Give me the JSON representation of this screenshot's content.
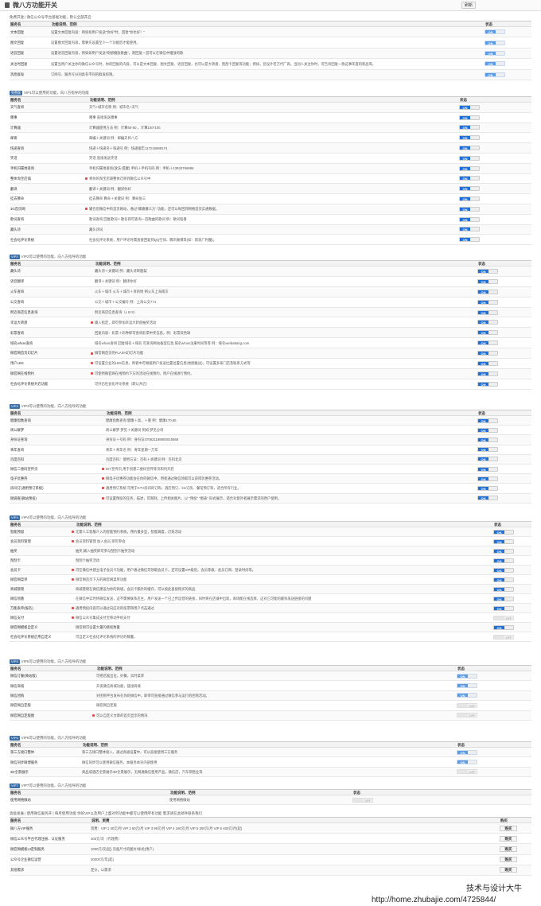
{
  "page": {
    "title": "微八方功能开关",
    "refresh_label": "刷新"
  },
  "colors": {
    "on": "#1e6fd9",
    "hot": "#e04848",
    "badge": "#3c6ea8"
  },
  "sections": [
    {
      "badge": "",
      "head": "免费开放 | 微信公众号平台基础功能，默认全部开启",
      "cols": [
        "服务名",
        "功能说明、范例",
        "状态"
      ],
      "colw": [
        52,
        545,
        59
      ],
      "rows": [
        {
          "n": "文本回复",
          "d": "设置文本回复内容：例如如用户发送\"你好\"时，回复\"你也好！\"",
          "s": "on",
          "lite": true
        },
        {
          "n": "图文回复",
          "d": "设置图文回复内容，需要先设置至少一个功能后才能使用。",
          "s": "on",
          "lite": true
        },
        {
          "n": "语音回复",
          "d": "设置语音回复内容，例如如用户发送\"刚想播放歌曲\"，则回复一首可以在微信中播放的歌",
          "s": "on",
          "lite": true
        },
        {
          "n": "关注时回复",
          "d": "设置当用户关注你的微信公众号时，你的回复的内容，可以是文本回复、图文回复、语音回复，也可以是大转盘、刮刮卡回复等功能；例如，您设计若万代厂商，当别人关注你时，可告诉回复一款这事年度的新品等。",
          "s": "on",
          "lite": true
        },
        {
          "n": "消息群发",
          "d": "订阅号、服务号分别具有不同的群发权限。",
          "s": "on",
          "lite": true
        }
      ],
      "hots": []
    },
    {
      "badge": "免费版",
      "head": "VIP1可以使用的功能，向八方指导的功能",
      "cols": [
        "服务名",
        "功能说明、范例",
        "状态"
      ],
      "colw": [
        100,
        465,
        91
      ],
      "rows": [
        {
          "n": "天气查询",
          "d": "天气+城市名称 例：城市名+天气",
          "s": "on"
        },
        {
          "n": "糗事",
          "d": "糗事    直接发送糗事",
          "s": "on"
        },
        {
          "n": "计算器",
          "d": "计算器使用方法   例：计算50-50    ，计算100*100",
          "s": "on"
        },
        {
          "n": "邮寄",
          "d": "邮编＋关键词   例：邮编天目八方",
          "s": "on"
        },
        {
          "n": "快递查询",
          "d": "快递＋快递名＋快递号   例：快递顺丰117215889174",
          "s": "on"
        },
        {
          "n": "笑话",
          "d": "笑话    直接发送笑话",
          "s": "on"
        },
        {
          "n": "手机归属地查询",
          "d": "手机归属地查询(放法:提醒)  手机＋手机号码   例：手机＋13933766996",
          "s": "on"
        },
        {
          "n": "整体淘宝店铺",
          "d": "将你的淘宝店铺整体迁移到微信公众号中",
          "s": "on",
          "hot": true
        },
        {
          "n": "翻译",
          "d": "翻译＋关键词  例：翻译你好",
          "s": "on"
        },
        {
          "n": "挂去算命",
          "d": "挂去算命 算命＋关键词   例：算命张三",
          "s": "on"
        },
        {
          "n": "3G首页网",
          "d": "输合您微信中的首页网站，通过\"输输播三方\" 功能，还可以每回到网络首页实通数据。",
          "s": "on",
          "hot": true
        },
        {
          "n": "歌词查询",
          "d": "歌词查询 回复歌词＋歌名即可查询一首歌曲的歌词 例：歌词稻香",
          "s": "on"
        },
        {
          "n": "藏头诗",
          "d": "藏头诗词",
          "s": "on"
        },
        {
          "n": "社会化评论系统",
          "d": "社会化评论系统，用户评论时需直接回复到QQ空间、腾讯微博等(如：新浪广利魔)。",
          "s": "on"
        }
      ]
    },
    {
      "badge": "VIP2",
      "head": "VIP2可以使用的功能，向八方指导的功能",
      "cols": [
        "服务名",
        "功能说明、范例",
        "状态"
      ],
      "colw": [
        107,
        481,
        68
      ],
      "rows": [
        {
          "n": "藏头诗",
          "d": "藏头诗＋关键词   例：藏头诗转题梨",
          "s": "on"
        },
        {
          "n": "语音翻译",
          "d": "翻译＋关键词   例：翻译你好",
          "s": "on"
        },
        {
          "n": "火车查询",
          "d": "火车＋城市   火车＋城市＋目的地   例火车上海南京",
          "s": "on"
        },
        {
          "n": "公交查询",
          "d": "公交＋城市＋公交编号   例：上海公交774",
          "s": "on"
        },
        {
          "n": "附近商店信息查询",
          "d": "附近商店信息查询（L B S）",
          "s": "on"
        },
        {
          "n": "幸运大转盘",
          "d": "输入指定，即可参加幸运大转盘抽奖活动",
          "s": "on",
          "hot": true
        },
        {
          "n": "彩票查询",
          "d": "回复内容：彩票＋彩种即可查询彩票中奖信息，例：彩票双色球",
          "s": "on"
        },
        {
          "n": "域名whois查询",
          "d": "域名whois查询   回复域名＋域名 可查询网站备案信息,域名whois注册时间等等 例：域名weiba8ang.com",
          "s": "on"
        },
        {
          "n": "微官网首页幻灯片",
          "d": "微官网首页的FLASH幻灯片功能",
          "s": "on",
          "hot": true
        },
        {
          "n": "用户LBS",
          "d": "可设置企业的LBS信息，用者中可根据用户发送位置位置信息(地图推送)，可设置多家门店及联系方式等",
          "s": "on",
          "hot": true
        },
        {
          "n": "微官网在线预约",
          "d": "可使用微官网在线预约下方的活动在线预约，用户在线进行预约。",
          "s": "on",
          "hot": true
        },
        {
          "n": "社会化评论系统开启功能",
          "d": "可开启社会化评论系统（默认开启）",
          "s": "on"
        }
      ]
    },
    {
      "badge": "VIP3",
      "head": "VIP3可以使用的功能，向八方指导的功能",
      "cols": [
        "服务名",
        "功能说明、范例",
        "状态"
      ],
      "colw": [
        121,
        467,
        68
      ],
      "rows": [
        {
          "n": "健康指数查询",
          "d": "健康指数查询  健康＋高，＋重   例：健康170,65",
          "s": "on"
        },
        {
          "n": "周公解梦",
          "d": "周公解梦  梦见＋关键词   例如:梦见分母",
          "s": "on"
        },
        {
          "n": "身份证查询",
          "d": "身份证＋号码    例：身份证370821198800015568",
          "s": "on"
        },
        {
          "n": "青年查询",
          "d": "青年＋青年名   例：青年星期一万年",
          "s": "on"
        },
        {
          "n": "百度百科",
          "d": "百度百科：使用方法：百科＋关键词   例：百科北京",
          "s": "on"
        },
        {
          "n": "微信二维码宣传页",
          "d": "DIY宣传页,用于创建二维码宣传等页和列开后",
          "s": "on",
          "hot": true
        },
        {
          "n": "电子优惠券",
          "d": "网电子优惠券功能会在你的微信中，用者通过微信领取可以获得优惠券活动。",
          "s": "on",
          "hot": true
        },
        {
          "n": "房间订(通用预订系统)",
          "d": "通用预订系统 可用于KTV房间的订购、酒店预订、ktv订房、餐馆预订等，适合所有行业。",
          "s": "on",
          "hot": true
        },
        {
          "n": "微调查(微站预投)",
          "d": "可设置预投的任务，描述，可限制，上传相关图片，以 \"预投\"  \"图表\" 形式展示，适合对意外者展示需求的用户使用。",
          "s": "on",
          "hot": true
        }
      ]
    },
    {
      "badge": "VIP4",
      "head": "VIP4可以使用的功能，向八方指导的功能",
      "cols": [
        "服务名",
        "功能说明、范例",
        "状态"
      ],
      "colw": [
        83,
        525,
        48
      ],
      "rows": [
        {
          "n": "智能预留",
          "d": "无需人工客服介入的智能预约系统，预约最多显，智能调度，灯笼活动",
          "s": "on",
          "hot": true
        },
        {
          "n": "会员资料管理",
          "d": "会员资料管理  加入会员   即可参会",
          "s": "on",
          "hot": true
        },
        {
          "n": "抽奖",
          "d": "抽奖,输入抽奖即可参与刮刮卡抽奖活动",
          "s": "on"
        },
        {
          "n": "刮刮卡",
          "d": "刮刮卡抽奖活动",
          "s": "on"
        },
        {
          "n": "会员卡",
          "d": "可在微信中建立电子会员卡功能，用户通过微信可领取会员卡，还可设置VIP级别，会员等级、会员订阅、登录时间等。",
          "s": "on",
          "hot": true
        },
        {
          "n": "微官网菜单",
          "d": "微官网首页下方的微官网菜单功能",
          "s": "on",
          "hot": true
        },
        {
          "n": "商城管理",
          "d": "商城管理在微信建设为你的商城，会员卡额外的缓存，可以按此直接购买的商品",
          "s": "on"
        },
        {
          "n": "微信喷墨",
          "d": "在微信中实时将微信发送，这不需要联系店主，用户发送一个已上传运营的链接，同时将在店铺中出现，商场能在线选择，这对它可能的最快发送链接的问题",
          "s": "on"
        },
        {
          "n": "万能表单(报名)",
          "d": "通用预投内容可以通过向应对的投票和用户点击通过",
          "s": "on",
          "hot": true
        },
        {
          "n": "微信支付",
          "d": "微信公众号集成支付宝移动手机支付",
          "s": "off",
          "hot": true
        },
        {
          "n": "微官网模板自定义",
          "d": "微官网可设置大量的模板数量",
          "s": "on"
        },
        {
          "n": "社会化评论系统启用自定义",
          "d": "可自定义社会化评论系统的评论的数量。",
          "s": "off"
        }
      ]
    },
    {
      "badge": "VIP5",
      "head": "VIP5可以使用的功能，向八方指导的功能",
      "cols": [
        "服务名",
        "功能说明、范例",
        "状态"
      ],
      "colw": [
        109,
        453,
        94
      ],
      "rows": [
        {
          "n": "微信订餐(微站版)",
          "d": "可把店面出位，好餐，实时菜库",
          "s": "on",
          "lite": true
        },
        {
          "n": "微信商城",
          "d": "开发微信商城功能，链接商城",
          "s": "on",
          "lite": true
        },
        {
          "n": "微信团购",
          "d": "对团购平台发布在你的微信中，即带可直接通过微信参与运行的团购活动。",
          "s": "on",
          "lite": true
        },
        {
          "n": "微官网自定版",
          "d": "微官网自定版",
          "s": "off"
        },
        {
          "n": "微官网自定版图",
          "d": "可以自定义文章的首页显示的情况",
          "s": "off",
          "hot": true
        }
      ]
    },
    {
      "badge": "VIP6",
      "head": "VIP6可以使用的功能，向八方指导的功能",
      "cols": [
        "服务名",
        "功能说明、范例",
        "状态"
      ],
      "colw": [
        91,
        471,
        94
      ],
      "rows": [
        {
          "n": "第三方接口整体",
          "d": "第三方接口整体接入，通过高级设置中，可以直接使用三方服务",
          "s": "on",
          "lite": true
        },
        {
          "n": "微信同步微博服务",
          "d": "微信同步可以使用微信服务，本服务本对内部使用",
          "s": "on",
          "lite": true
        },
        {
          "n": "3D全景展示",
          "d": "商品或酒店全景展示3D全景展示，无网通微信使用产品，微信店，汽车销售业等",
          "s": "off"
        }
      ]
    },
    {
      "badge": "VIP7",
      "head": "VIP7可以使用的功能，向八方指导的功能",
      "cols": [
        "服务名",
        "功能说明、范例",
        "状态"
      ],
      "colw": [
        201,
        230,
        225
      ],
      "rows": [
        {
          "n": "使用网络微站",
          "d": "使用网络微站",
          "s": "off"
        }
      ]
    }
  ],
  "pricing": {
    "head": "高级发展 | 使用微信服务开 | 每月使用功能 你的VIP以及用户上面对列功能中都可以使用所有功能   需求请在此邮件联系我们",
    "cols": [
      "服务名",
      "说明、资费",
      "购买"
    ],
    "rows": [
      {
        "n": "微八方VIP服务",
        "d": "资费：VIP 1    30元/月              VIP 2    50元/月       VIP 3    99元/月       VIP 4    180元/月        VIP 5    300元/月        VIP 6    400元/月(起)",
        "b": "购买"
      },
      {
        "n": "微信公众号平台代理注册、认证服务",
        "d": "300元/次（代理费）",
        "b": "购买"
      },
      {
        "n": "微官网模板UI定制服务",
        "d": "1000元/次(起) 页面尺寸的图片/样式(用户)",
        "b": "购买"
      },
      {
        "n": "公众号企业微信运营",
        "d": "30000元/年(起)",
        "b": "购买"
      },
      {
        "n": "其他需求",
        "d": "定价，以需求",
        "b": "购买"
      }
    ]
  },
  "watermark": {
    "line1": "技术与设计大牛",
    "line2": "http://home.zhubajie.com/4725844/"
  }
}
